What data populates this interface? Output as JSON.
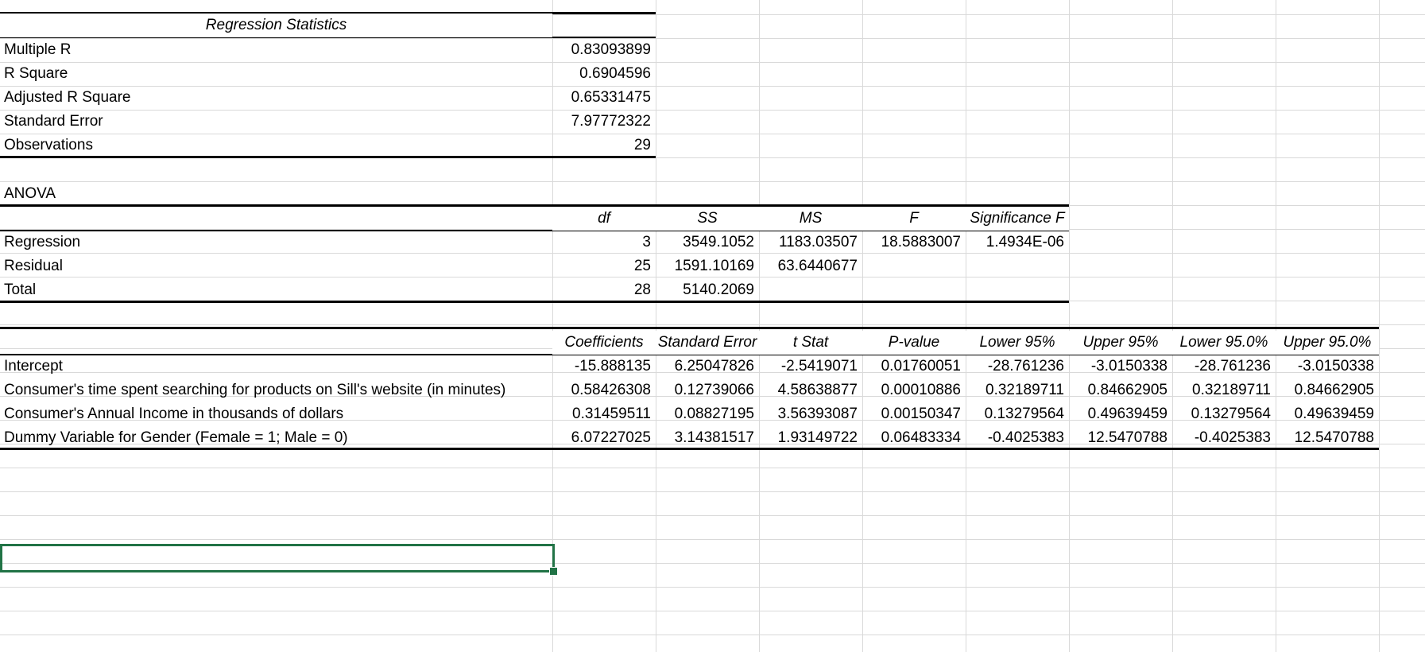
{
  "summary_output": {
    "regression_statistics": {
      "title": "Regression Statistics",
      "rows": [
        {
          "label": "Multiple R",
          "value": "0.83093899"
        },
        {
          "label": "R Square",
          "value": "0.6904596"
        },
        {
          "label": "Adjusted R Square",
          "value": "0.65331475"
        },
        {
          "label": "Standard Error",
          "value": "7.97772322"
        },
        {
          "label": "Observations",
          "value": "29"
        }
      ]
    },
    "anova": {
      "title": "ANOVA",
      "headers": [
        "df",
        "SS",
        "MS",
        "F",
        "Significance F"
      ],
      "rows": [
        {
          "label": "Regression",
          "cells": [
            "3",
            "3549.1052",
            "1183.03507",
            "18.5883007",
            "1.4934E-06"
          ]
        },
        {
          "label": "Residual",
          "cells": [
            "25",
            "1591.10169",
            "63.6440677",
            "",
            ""
          ]
        },
        {
          "label": "Total",
          "cells": [
            "28",
            "5140.2069",
            "",
            "",
            ""
          ]
        }
      ]
    },
    "coefficients": {
      "headers": [
        "Coefficients",
        "Standard Error",
        "t Stat",
        "P-value",
        "Lower 95%",
        "Upper 95%",
        "Lower 95.0%",
        "Upper 95.0%"
      ],
      "rows": [
        {
          "label": "Intercept",
          "cells": [
            "-15.888135",
            "6.25047826",
            "-2.5419071",
            "0.01760051",
            "-28.761236",
            "-3.0150338",
            "-28.761236",
            "-3.0150338"
          ]
        },
        {
          "label": "Consumer's time spent searching for products on Sill's website (in minutes)",
          "cells": [
            "0.58426308",
            "0.12739066",
            "4.58638877",
            "0.00010886",
            "0.32189711",
            "0.84662905",
            "0.32189711",
            "0.84662905"
          ]
        },
        {
          "label": "Consumer's Annual Income in thousands of dollars",
          "cells": [
            "0.31459511",
            "0.08827195",
            "3.56393087",
            "0.00150347",
            "0.13279564",
            "0.49639459",
            "0.13279564",
            "0.49639459"
          ]
        },
        {
          "label": "Dummy Variable for Gender (Female = 1; Male = 0)",
          "cells": [
            "6.07227025",
            "3.14381517",
            "1.93149722",
            "0.06483334",
            "-0.4025383",
            "12.5470788",
            "-0.4025383",
            "12.5470788"
          ]
        }
      ]
    }
  },
  "colors": {
    "gridline": "#d9d9d9",
    "selection": "#217346",
    "text": "#000000"
  }
}
